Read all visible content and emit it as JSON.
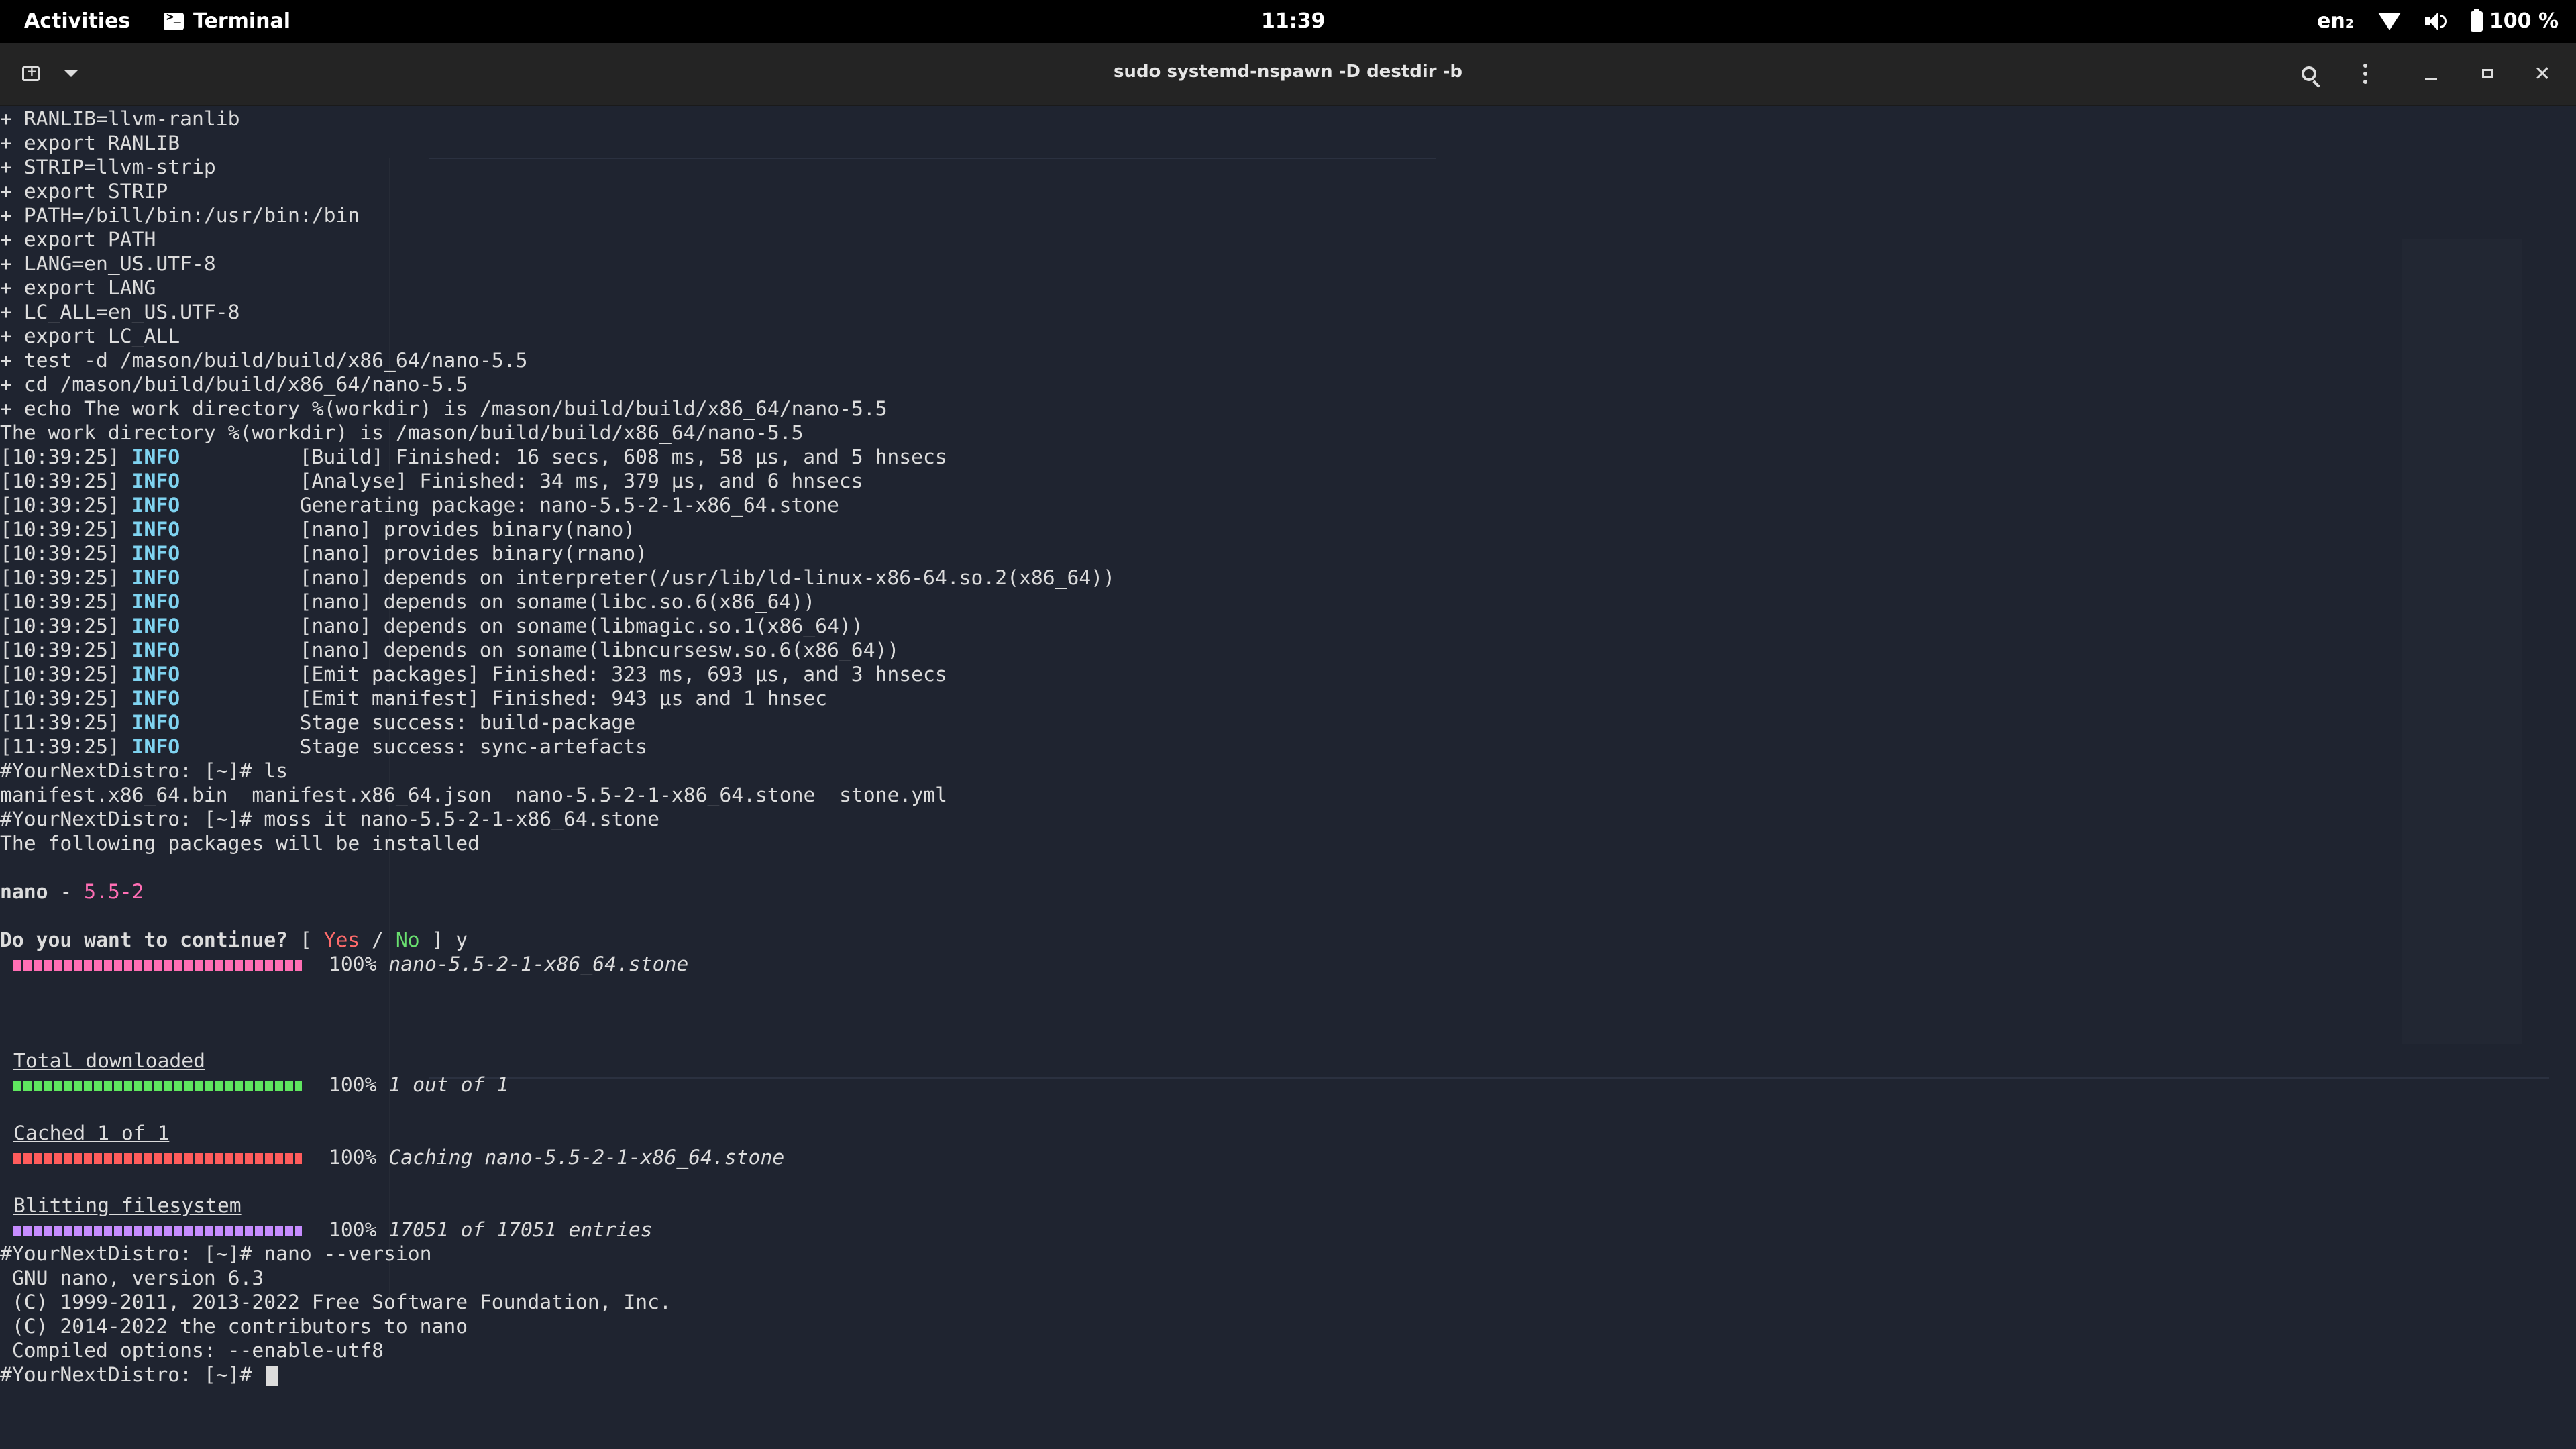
{
  "topbar": {
    "activities": "Activities",
    "app_name": "Terminal",
    "clock": "11:39",
    "lang": "en₂",
    "battery": "100 %"
  },
  "window": {
    "title": "sudo systemd-nspawn -D destdir -b"
  },
  "terminal": {
    "env_lines": [
      "+ RANLIB=llvm-ranlib",
      "+ export RANLIB",
      "+ STRIP=llvm-strip",
      "+ export STRIP",
      "+ PATH=/bill/bin:/usr/bin:/bin",
      "+ export PATH",
      "+ LANG=en_US.UTF-8",
      "+ export LANG",
      "+ LC_ALL=en_US.UTF-8",
      "+ export LC_ALL",
      "+ test -d /mason/build/build/x86_64/nano-5.5",
      "+ cd /mason/build/build/x86_64/nano-5.5",
      "+ echo The work directory %(workdir) is /mason/build/build/x86_64/nano-5.5",
      "The work directory %(workdir) is /mason/build/build/x86_64/nano-5.5"
    ],
    "log_lines": [
      {
        "ts": "[10:39:25]",
        "level": "INFO",
        "msg": "[Build] Finished: 16 secs, 608 ms, 58 μs, and 5 hnsecs"
      },
      {
        "ts": "[10:39:25]",
        "level": "INFO",
        "msg": "[Analyse] Finished: 34 ms, 379 μs, and 6 hnsecs"
      },
      {
        "ts": "[10:39:25]",
        "level": "INFO",
        "msg": "Generating package: nano-5.5-2-1-x86_64.stone"
      },
      {
        "ts": "[10:39:25]",
        "level": "INFO",
        "msg": "[nano] provides binary(nano)"
      },
      {
        "ts": "[10:39:25]",
        "level": "INFO",
        "msg": "[nano] provides binary(rnano)"
      },
      {
        "ts": "[10:39:25]",
        "level": "INFO",
        "msg": "[nano] depends on interpreter(/usr/lib/ld-linux-x86-64.so.2(x86_64))"
      },
      {
        "ts": "[10:39:25]",
        "level": "INFO",
        "msg": "[nano] depends on soname(libc.so.6(x86_64))"
      },
      {
        "ts": "[10:39:25]",
        "level": "INFO",
        "msg": "[nano] depends on soname(libmagic.so.1(x86_64))"
      },
      {
        "ts": "[10:39:25]",
        "level": "INFO",
        "msg": "[nano] depends on soname(libncursesw.so.6(x86_64))"
      },
      {
        "ts": "[10:39:25]",
        "level": "INFO",
        "msg": "[Emit packages] Finished: 323 ms, 693 μs, and 3 hnsecs"
      },
      {
        "ts": "[10:39:25]",
        "level": "INFO",
        "msg": "[Emit manifest] Finished: 943 μs and 1 hnsec"
      },
      {
        "ts": "[11:39:25]",
        "level": "INFO",
        "msg": "Stage success: build-package"
      },
      {
        "ts": "[11:39:25]",
        "level": "INFO",
        "msg": "Stage success: sync-artefacts"
      }
    ],
    "prompt": "#YourNextDistro: [~]# ",
    "cmd_ls": "ls",
    "ls_output": "manifest.x86_64.bin  manifest.x86_64.json  nano-5.5-2-1-x86_64.stone  stone.yml",
    "cmd_moss": "moss it nano-5.5-2-1-x86_64.stone",
    "install_msg": "The following packages will be installed",
    "pkg_name": "nano",
    "pkg_sep": " - ",
    "pkg_version": "5.5-2",
    "question": "Do you want to continue?",
    "q_open": " [ ",
    "q_yes": "Yes",
    "q_slash": " / ",
    "q_no": "No",
    "q_close": " ] ",
    "answer": "y",
    "progress": [
      {
        "heading": "",
        "percent": 100,
        "percent_label": "100%",
        "detail": "nano-5.5-2-1-x86_64.stone",
        "color": "#ff6eb4"
      },
      {
        "heading": "Total downloaded",
        "percent": 100,
        "percent_label": "100%",
        "detail": "1 out of 1",
        "color": "#5fe65f"
      },
      {
        "heading": "Cached 1 of 1",
        "percent": 100,
        "percent_label": "100%",
        "detail": "Caching nano-5.5-2-1-x86_64.stone",
        "color": "#ff5c5c"
      },
      {
        "heading": "Blitting filesystem",
        "percent": 100,
        "percent_label": "100%",
        "detail": "17051 of 17051 entries",
        "color": "#c68cff"
      }
    ],
    "cmd_nano": "nano --version",
    "nano_version_lines": [
      " GNU nano, version 6.3",
      " (C) 1999-2011, 2013-2022 Free Software Foundation, Inc.",
      " (C) 2014-2022 the contributors to nano",
      " Compiled options: --enable-utf8"
    ]
  }
}
